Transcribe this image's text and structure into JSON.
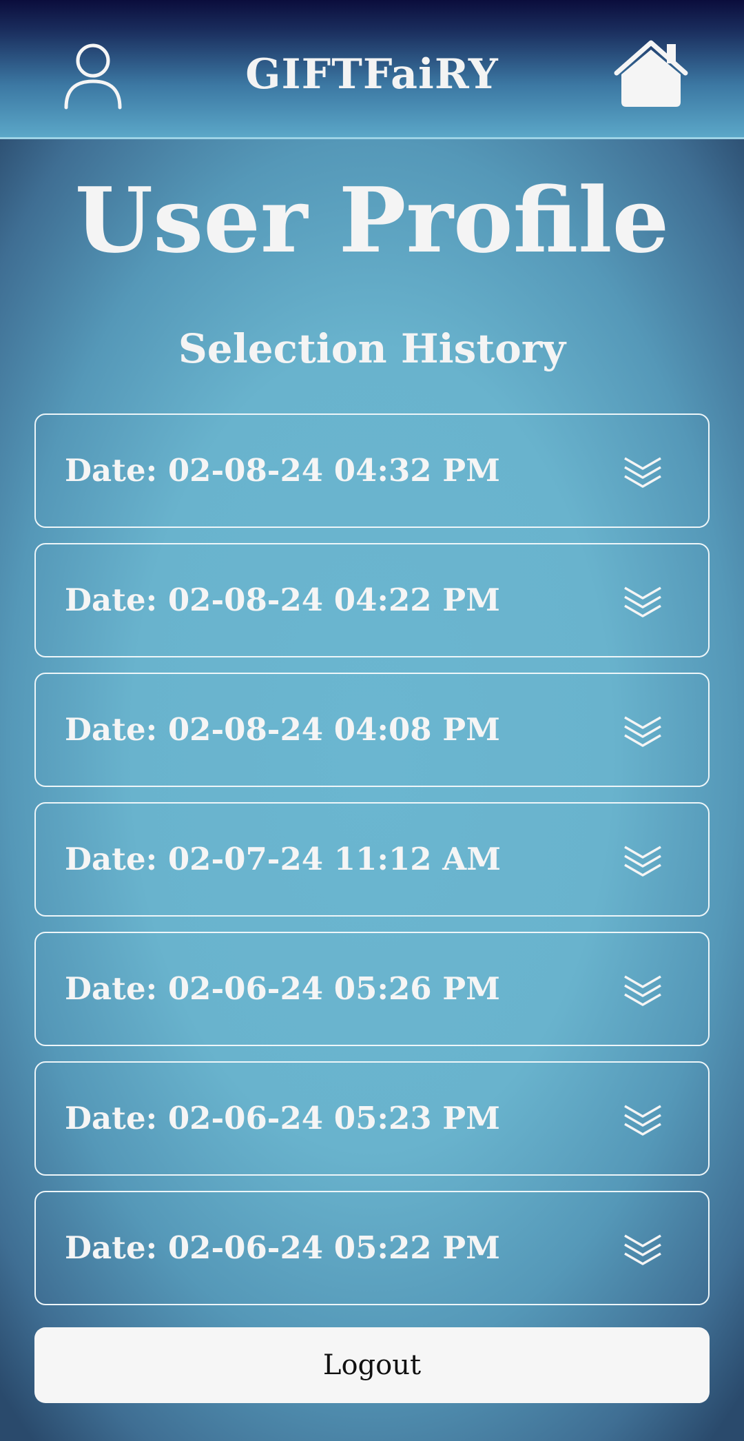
{
  "header": {
    "brand": "GIFTFaiRY",
    "user_icon": "user-profile-icon",
    "home_icon": "home-icon"
  },
  "page": {
    "title": "User Profile",
    "section_title": "Selection History"
  },
  "history": {
    "items": [
      {
        "label": "Date: 02-08-24 04:32 PM",
        "icon": "expand-chevrons-icon"
      },
      {
        "label": "Date: 02-08-24 04:22 PM",
        "icon": "expand-chevrons-icon"
      },
      {
        "label": "Date: 02-08-24 04:08 PM",
        "icon": "expand-chevrons-icon"
      },
      {
        "label": "Date: 02-07-24 11:12 AM",
        "icon": "expand-chevrons-icon"
      },
      {
        "label": "Date: 02-06-24 05:26 PM",
        "icon": "expand-chevrons-icon"
      },
      {
        "label": "Date: 02-06-24 05:23 PM",
        "icon": "expand-chevrons-icon"
      },
      {
        "label": "Date: 02-06-24 05:22 PM",
        "icon": "expand-chevrons-icon"
      }
    ]
  },
  "footer": {
    "logout_label": "Logout"
  },
  "colors": {
    "header_top": "#0b0d3c",
    "header_bottom": "#5ba7c8",
    "background_center": "#6bb6d0",
    "background_edge": "#2a4a6c",
    "text": "#f5f5f5",
    "button_bg": "#f6f6f6"
  }
}
